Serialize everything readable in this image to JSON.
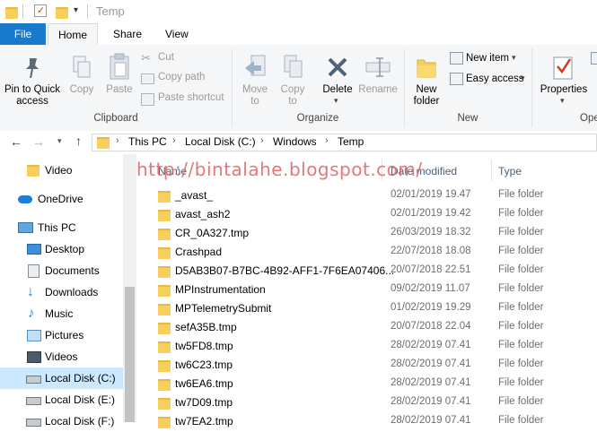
{
  "window": {
    "title": "Temp"
  },
  "ribbon_tabs": {
    "file": "File",
    "home": "Home",
    "share": "Share",
    "view": "View"
  },
  "ribbon": {
    "pin_label": "Pin to Quick\naccess",
    "copy_label": "Copy",
    "paste_label": "Paste",
    "cut_label": "Cut",
    "copy_path_label": "Copy path",
    "paste_shortcut_label": "Paste shortcut",
    "clipboard_group": "Clipboard",
    "move_to_label": "Move\nto",
    "copy_to_label": "Copy\nto",
    "delete_label": "Delete",
    "rename_label": "Rename",
    "organize_group": "Organize",
    "new_folder_label": "New\nfolder",
    "new_item_label": "New item",
    "easy_access_label": "Easy access",
    "new_group": "New",
    "properties_label": "Properties",
    "open_group": "Ope"
  },
  "address": {
    "crumbs": [
      "This PC",
      "Local Disk (C:)",
      "Windows",
      "Temp"
    ]
  },
  "nav": {
    "items": [
      {
        "label": "Video",
        "icon": "folder-icon"
      },
      {
        "label": "OneDrive",
        "icon": "onedrive-icon"
      },
      {
        "label": "This PC",
        "icon": "computer-icon"
      },
      {
        "label": "Desktop",
        "icon": "desktop-icon"
      },
      {
        "label": "Documents",
        "icon": "documents-icon"
      },
      {
        "label": "Downloads",
        "icon": "downloads-icon"
      },
      {
        "label": "Music",
        "icon": "music-icon"
      },
      {
        "label": "Pictures",
        "icon": "pictures-icon"
      },
      {
        "label": "Videos",
        "icon": "videos-icon"
      },
      {
        "label": "Local Disk (C:)",
        "icon": "disk-icon"
      },
      {
        "label": "Local Disk (E:)",
        "icon": "disk-icon"
      },
      {
        "label": "Local Disk (F:)",
        "icon": "disk-icon"
      }
    ]
  },
  "columns": {
    "name": "Name",
    "date": "Date modified",
    "type": "Type"
  },
  "watermark": "http://bintalahe.blogspot.com/",
  "files": [
    {
      "name": "_avast_",
      "date": "02/01/2019 19.47",
      "type": "File folder"
    },
    {
      "name": "avast_ash2",
      "date": "02/01/2019 19.42",
      "type": "File folder"
    },
    {
      "name": "CR_0A327.tmp",
      "date": "26/03/2019 18.32",
      "type": "File folder"
    },
    {
      "name": "Crashpad",
      "date": "22/07/2018 18.08",
      "type": "File folder"
    },
    {
      "name": "D5AB3B07-B7BC-4B92-AFF1-7F6EA07406...",
      "date": "20/07/2018 22.51",
      "type": "File folder"
    },
    {
      "name": "MPInstrumentation",
      "date": "09/02/2019 11.07",
      "type": "File folder"
    },
    {
      "name": "MPTelemetrySubmit",
      "date": "01/02/2019 19.29",
      "type": "File folder"
    },
    {
      "name": "sefA35B.tmp",
      "date": "20/07/2018 22.04",
      "type": "File folder"
    },
    {
      "name": "tw5FD8.tmp",
      "date": "28/02/2019 07.41",
      "type": "File folder"
    },
    {
      "name": "tw6C23.tmp",
      "date": "28/02/2019 07.41",
      "type": "File folder"
    },
    {
      "name": "tw6EA6.tmp",
      "date": "28/02/2019 07.41",
      "type": "File folder"
    },
    {
      "name": "tw7D09.tmp",
      "date": "28/02/2019 07.41",
      "type": "File folder"
    },
    {
      "name": "tw7EA2.tmp",
      "date": "28/02/2019 07.41",
      "type": "File folder"
    }
  ],
  "colors": {
    "accent": "#1979ca",
    "selected": "#cce8ff",
    "folder": "#f6cf5c"
  }
}
